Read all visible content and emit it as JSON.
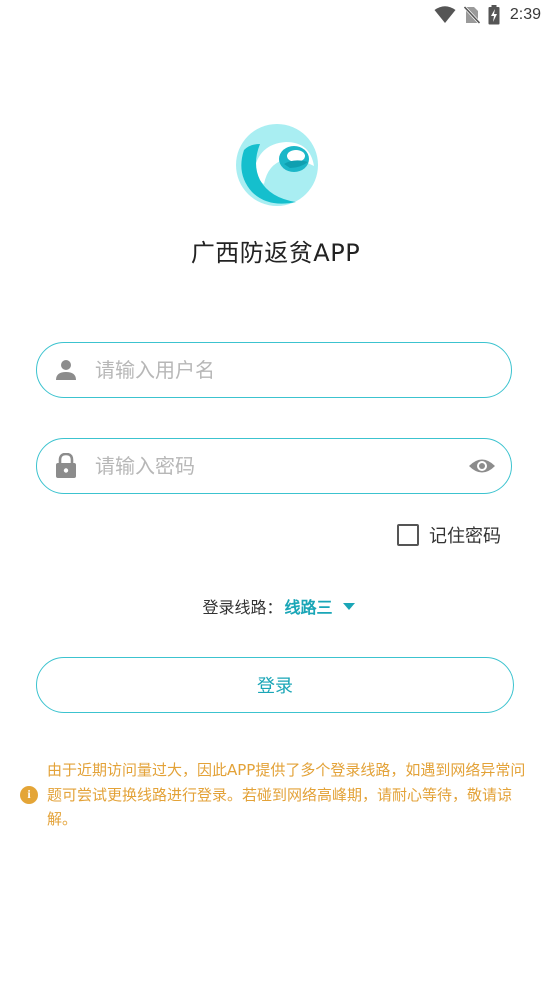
{
  "status_bar": {
    "time": "2:39",
    "icons": [
      "wifi-icon",
      "no-sim-icon",
      "battery-charging-icon"
    ]
  },
  "app": {
    "title": "广西防返贫APP",
    "logo": "app-logo"
  },
  "login_form": {
    "username": {
      "placeholder": "请输入用户名",
      "value": "",
      "icon": "person-icon"
    },
    "password": {
      "placeholder": "请输入密码",
      "value": "",
      "icon": "lock-icon",
      "toggle_icon": "eye-icon"
    },
    "remember_label": "记住密码",
    "remember_checked": false,
    "route_label": "登录线路：",
    "route_value": "线路三",
    "login_label": "登录"
  },
  "notice": {
    "icon": "info-icon",
    "text": "由于近期访问量过大，因此APP提供了多个登录线路，如遇到网络异常问题可尝试更换线路进行登录。若碰到网络高峰期，请耐心等待，敬请谅解。"
  },
  "colors": {
    "accent": "#1aa6b7",
    "border": "#3cc3cf",
    "notice": "#e3a238"
  }
}
